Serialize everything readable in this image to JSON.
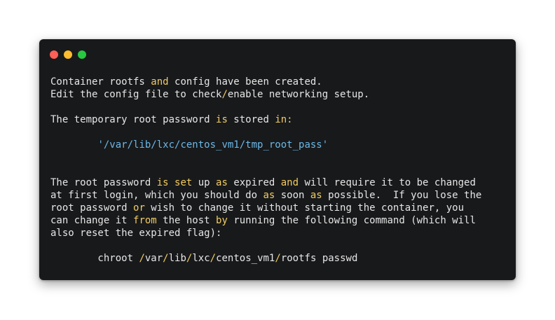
{
  "window": {
    "traffic_lights": [
      {
        "name": "close",
        "color": "#ff5f57"
      },
      {
        "name": "minimize",
        "color": "#febc2e"
      },
      {
        "name": "zoom",
        "color": "#28c840"
      }
    ]
  },
  "colors": {
    "background": "#18191b",
    "text": "#e6e6e6",
    "keyword": "#f2cc60",
    "string": "#6cb8e6"
  },
  "lines": [
    [
      {
        "t": "Container rootfs "
      },
      {
        "t": "and",
        "k": "kw"
      },
      {
        "t": " config have been created."
      }
    ],
    [
      {
        "t": "Edit the config file to check"
      },
      {
        "t": "/",
        "k": "op"
      },
      {
        "t": "enable networking setup."
      }
    ],
    [],
    [
      {
        "t": "The temporary root password "
      },
      {
        "t": "is",
        "k": "kw"
      },
      {
        "t": " stored "
      },
      {
        "t": "in:",
        "k": "kw"
      }
    ],
    [],
    [
      {
        "t": "        "
      },
      {
        "t": "'/var/lib/lxc/centos_vm1/tmp_root_pass'",
        "k": "str"
      }
    ],
    [],
    [],
    [
      {
        "t": "The root password "
      },
      {
        "t": "is",
        "k": "kw"
      },
      {
        "t": " "
      },
      {
        "t": "set",
        "k": "kw"
      },
      {
        "t": " up "
      },
      {
        "t": "as",
        "k": "kw"
      },
      {
        "t": " expired "
      },
      {
        "t": "and",
        "k": "kw"
      },
      {
        "t": " will require it to be changed"
      }
    ],
    [
      {
        "t": "at first login, which you should do "
      },
      {
        "t": "as",
        "k": "kw"
      },
      {
        "t": " soon "
      },
      {
        "t": "as",
        "k": "kw"
      },
      {
        "t": " possible.  If you lose the"
      }
    ],
    [
      {
        "t": "root password "
      },
      {
        "t": "or",
        "k": "kw"
      },
      {
        "t": " wish to change it without starting the container, you"
      }
    ],
    [
      {
        "t": "can change it "
      },
      {
        "t": "from",
        "k": "kw"
      },
      {
        "t": " the host "
      },
      {
        "t": "by",
        "k": "kw"
      },
      {
        "t": " running the following command (which will"
      }
    ],
    [
      {
        "t": "also reset the expired flag):"
      }
    ],
    [],
    [
      {
        "t": "        chroot "
      },
      {
        "t": "/",
        "k": "op"
      },
      {
        "t": "var"
      },
      {
        "t": "/",
        "k": "op"
      },
      {
        "t": "lib"
      },
      {
        "t": "/",
        "k": "op"
      },
      {
        "t": "lxc"
      },
      {
        "t": "/",
        "k": "op"
      },
      {
        "t": "centos_vm1"
      },
      {
        "t": "/",
        "k": "op"
      },
      {
        "t": "rootfs passwd"
      }
    ]
  ]
}
